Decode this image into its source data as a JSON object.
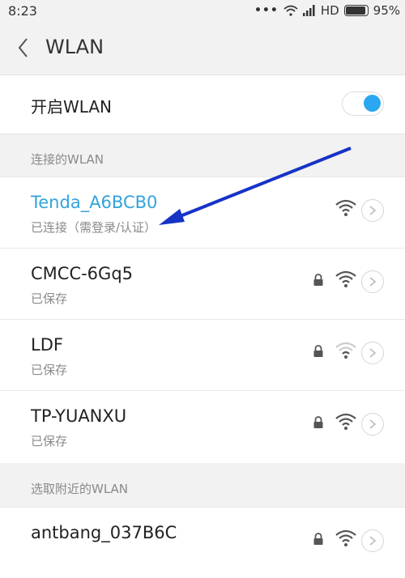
{
  "status_bar": {
    "time": "8:23",
    "network": "HD",
    "battery": "95%"
  },
  "header": {
    "title": "WLAN"
  },
  "toggle": {
    "label": "开启WLAN",
    "state": "on",
    "accent": "#2aa7f0"
  },
  "connected_section": {
    "header": "连接的WLAN",
    "network": {
      "ssid": "Tenda_A6BCB0",
      "status": "已连接（需登录/认证）",
      "color": "#33a3dc"
    }
  },
  "saved_networks": [
    {
      "ssid": "CMCC-6Gq5",
      "status": "已保存"
    },
    {
      "ssid": "LDF",
      "status": "已保存"
    },
    {
      "ssid": "TP-YUANXU",
      "status": "已保存"
    }
  ],
  "nearby_section": {
    "header": "选取附近的WLAN",
    "networks": [
      {
        "ssid": "antbang_037B6C"
      }
    ]
  },
  "annotation": {
    "arrow_color": "#1633c6"
  }
}
